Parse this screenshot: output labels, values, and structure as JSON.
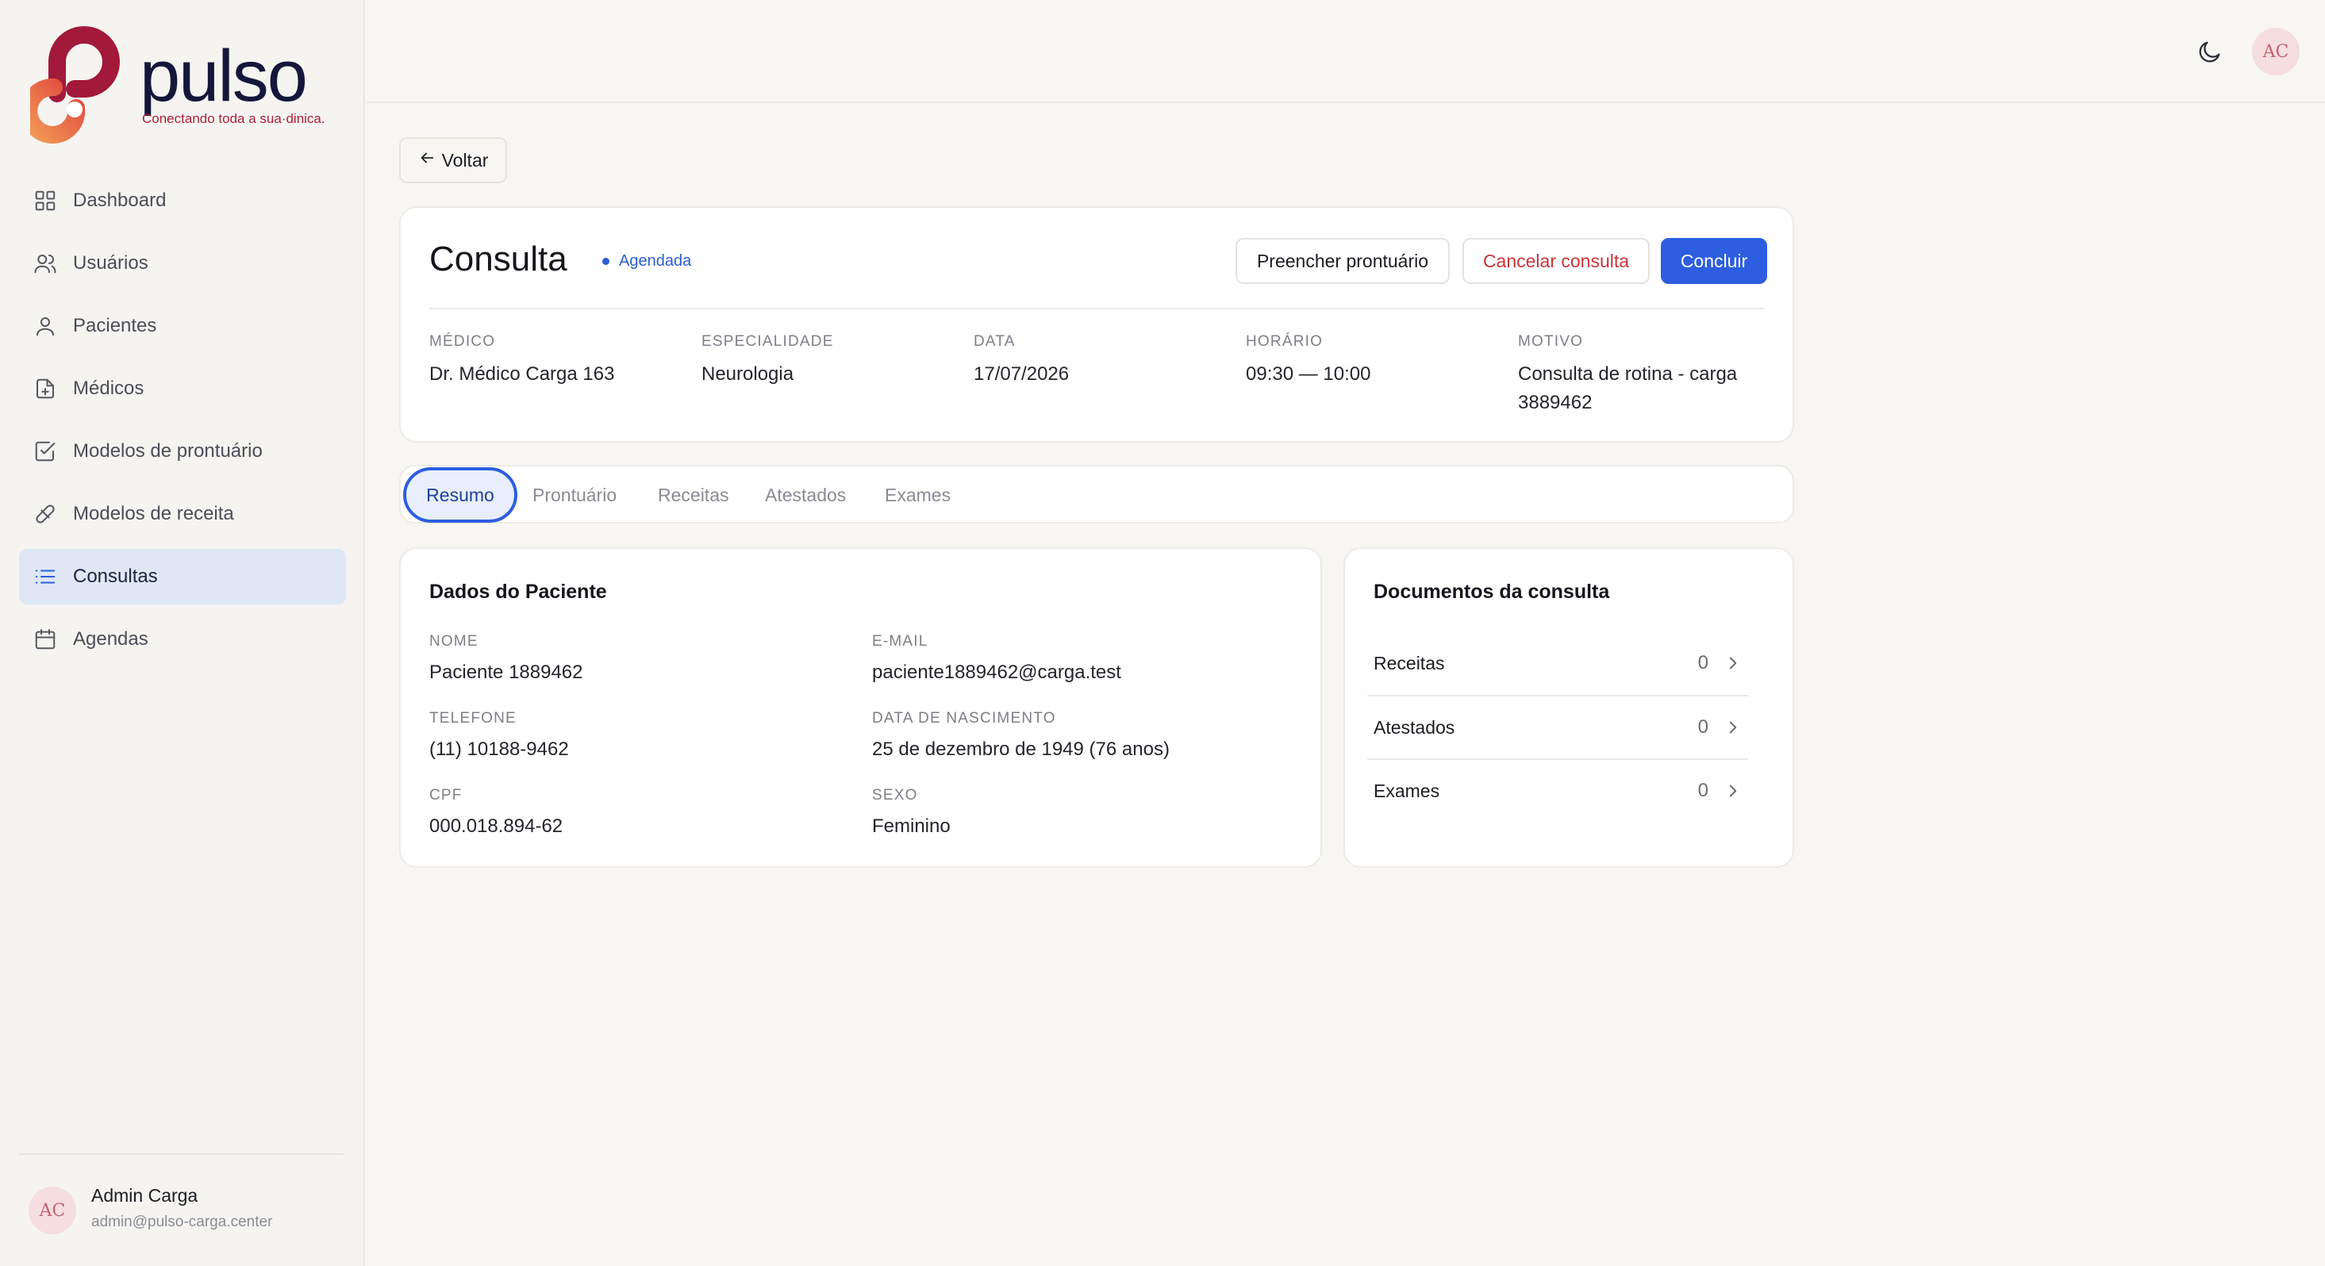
{
  "app": {
    "brand": "pulso",
    "tagline": "Conectando toda a sua·dinica.",
    "brand_colors": {
      "primary": "#b01f3c",
      "accent": "#f08a4b",
      "dark": "#15173a"
    }
  },
  "sidebar": {
    "items": [
      {
        "label": "Dashboard",
        "icon": "grid-icon"
      },
      {
        "label": "Usuários",
        "icon": "users-icon"
      },
      {
        "label": "Pacientes",
        "icon": "user-icon"
      },
      {
        "label": "Médicos",
        "icon": "file-plus-icon"
      },
      {
        "label": "Modelos de prontuário",
        "icon": "checkbox-icon"
      },
      {
        "label": "Modelos de receita",
        "icon": "pill-icon"
      },
      {
        "label": "Consultas",
        "icon": "list-icon",
        "active": true
      },
      {
        "label": "Agendas",
        "icon": "calendar-icon"
      }
    ],
    "user": {
      "initials": "AC",
      "name": "Admin Carga",
      "email": "admin@pulso-carga.center"
    }
  },
  "topbar": {
    "avatar_initials": "AC",
    "theme_icon": "moon-icon"
  },
  "back_button": {
    "label": "Voltar"
  },
  "consulta": {
    "title": "Consulta",
    "status": "Agendada",
    "status_color": "#2b5fd4",
    "actions": {
      "fill_record": "Preencher prontuário",
      "cancel": "Cancelar consulta",
      "complete": "Concluir"
    },
    "info": [
      {
        "label": "MÉDICO",
        "value": "Dr. Médico Carga 163"
      },
      {
        "label": "ESPECIALIDADE",
        "value": "Neurologia"
      },
      {
        "label": "DATA",
        "value": "17/07/2026"
      },
      {
        "label": "HORÁRIO",
        "value": "09:30 — 10:00"
      },
      {
        "label": "MOTIVO",
        "value": "Consulta de rotina - carga 3889462"
      }
    ]
  },
  "tabs": [
    {
      "label": "Resumo",
      "active": true
    },
    {
      "label": "Prontuário"
    },
    {
      "label": "Receitas"
    },
    {
      "label": "Atestados"
    },
    {
      "label": "Exames"
    }
  ],
  "patient": {
    "heading": "Dados do Paciente",
    "fields": [
      {
        "label": "NOME",
        "value": "Paciente 1889462"
      },
      {
        "label": "E-MAIL",
        "value": "paciente1889462@carga.test"
      },
      {
        "label": "TELEFONE",
        "value": "(11) 10188-9462"
      },
      {
        "label": "DATA DE NASCIMENTO",
        "value": "25 de dezembro de 1949 (76 anos)"
      },
      {
        "label": "CPF",
        "value": "000.018.894-62"
      },
      {
        "label": "SEXO",
        "value": "Feminino"
      }
    ]
  },
  "documents": {
    "heading": "Documentos da consulta",
    "rows": [
      {
        "label": "Receitas",
        "count": "0"
      },
      {
        "label": "Atestados",
        "count": "0"
      },
      {
        "label": "Exames",
        "count": "0"
      }
    ]
  }
}
